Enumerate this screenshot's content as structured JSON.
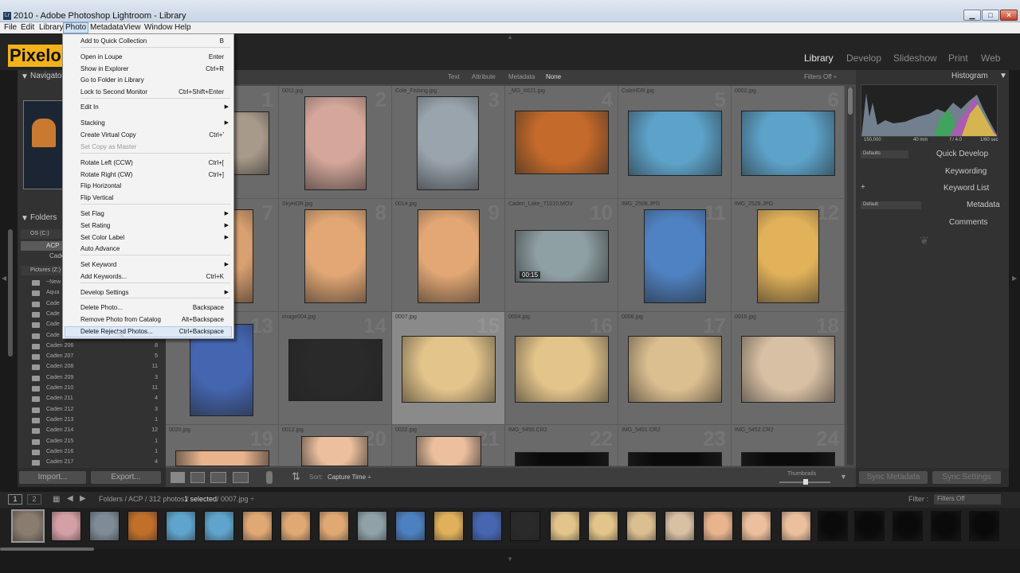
{
  "window": {
    "title": "2010 - Adobe Photoshop Lightroom - Library",
    "min": "▁",
    "max": "□",
    "close": "✕"
  },
  "menubar": [
    "File",
    "Edit",
    "Library",
    "Photo",
    "Metadata",
    "View",
    "Window",
    "Help"
  ],
  "logo": "Pixelo",
  "modules": [
    "Library",
    "Develop",
    "Slideshow",
    "Print",
    "Web"
  ],
  "filterbar": {
    "tabs": [
      "Text",
      "Attribute",
      "Metadata",
      "None"
    ],
    "status": "Filters Off ÷"
  },
  "left_panel": {
    "navigator": "Navigator",
    "folders": "Folders",
    "volume1": "OS (C:)",
    "volume2": "Pictures (Z:)",
    "acp": "ACP",
    "cade": "Cade",
    "folder_rows": [
      {
        "name": "~New",
        "count": ""
      },
      {
        "name": "Aqua",
        "count": ""
      },
      {
        "name": "Cade",
        "count": ""
      },
      {
        "name": "Cade",
        "count": ""
      },
      {
        "name": "Cade",
        "count": ""
      },
      {
        "name": "Cade",
        "count": ""
      },
      {
        "name": "Caden 206",
        "count": "8"
      },
      {
        "name": "Caden 207",
        "count": "5"
      },
      {
        "name": "Caden 208",
        "count": "11"
      },
      {
        "name": "Caden 209",
        "count": "3"
      },
      {
        "name": "Caden 210",
        "count": "11"
      },
      {
        "name": "Caden 211",
        "count": "4"
      },
      {
        "name": "Caden 212",
        "count": "3"
      },
      {
        "name": "Caden 213",
        "count": "1"
      },
      {
        "name": "Caden 214",
        "count": "12"
      },
      {
        "name": "Caden 215",
        "count": "1"
      },
      {
        "name": "Caden 216",
        "count": "1"
      },
      {
        "name": "Caden 217",
        "count": "4"
      }
    ]
  },
  "right_panel": {
    "histogram": "Histogram",
    "hist_info": [
      "150,000",
      "40 mm",
      "f / 4.0",
      "1/60 sec"
    ],
    "quick_develop": "Quick Develop",
    "keywording": "Keywording",
    "keyword_list": "Keyword List",
    "metadata": "Metadata",
    "comments": "Comments",
    "defaults": "Defaults",
    "default": "Default"
  },
  "grid": [
    {
      "file": "",
      "color": "#a89a8a"
    },
    {
      "file": "0011.jpg",
      "color": "#d4a79a"
    },
    {
      "file": "Cole_Fishing.jpg",
      "color": "#9aa4ad"
    },
    {
      "file": "_MG_8621.jpg",
      "color": "#c46a2a"
    },
    {
      "file": "ColeHDR.jpg",
      "color": "#5da2c9"
    },
    {
      "file": "0002.jpg",
      "color": "#5da2c9"
    },
    {
      "file": "",
      "color": "#d9a070"
    },
    {
      "file": "SkyHDR.jpg",
      "color": "#e2a774"
    },
    {
      "file": "0014.jpg",
      "color": "#e2a774"
    },
    {
      "file": "Caden_Lake_71010.MOV",
      "color": "#8fa0a4",
      "badge": "00:15"
    },
    {
      "file": "IMG_2508.JPG",
      "color": "#4f82c2"
    },
    {
      "file": "IMG_2528.JPG",
      "color": "#e2b25a"
    },
    {
      "file": "",
      "color": "#4465b0"
    },
    {
      "file": "image004.jpg",
      "color": "#2a2a2a"
    },
    {
      "file": "0007.jpg",
      "color": "#e3c48a"
    },
    {
      "file": "0004.jpg",
      "color": "#e3c48a"
    },
    {
      "file": "0008.jpg",
      "color": "#dcbf90"
    },
    {
      "file": "0016.jpg",
      "color": "#d8c0a4"
    },
    {
      "file": "0020.jpg",
      "color": "#e8b48e"
    },
    {
      "file": "0012.jpg",
      "color": "#ecc09e"
    },
    {
      "file": "0022.jpg",
      "color": "#ecc09e"
    },
    {
      "file": "IMG_5450.CR2",
      "color": "#0a0a0a"
    },
    {
      "file": "IMG_5451.CR2",
      "color": "#0a0a0a"
    },
    {
      "file": "IMG_5452.CR2",
      "color": "#0a0a0a"
    }
  ],
  "toolbar": {
    "sort_label": "Sort:",
    "sort_value": "Capture Time ÷",
    "thumbnails": "Thumbnails"
  },
  "buttons": {
    "import": "Import...",
    "export": "Export...",
    "sync_metadata": "Sync Metadata",
    "sync_settings": "Sync Settings"
  },
  "filmbar": {
    "page1": "1",
    "page2": "2",
    "path": "Folders / ACP / 312 photos /",
    "selected": "1 selected",
    "file": "/ 0007.jpg ÷",
    "filter_label": "Filter :",
    "filter_value": "Filters Off"
  },
  "filmstrip_colors": [
    "#8a7d70",
    "#d4a0a6",
    "#7f8b96",
    "#c0702a",
    "#5fa4cc",
    "#5fa4cc",
    "#e0a974",
    "#e0a974",
    "#e0a974",
    "#90a2a8",
    "#4d80c0",
    "#e0b05a",
    "#4666b2",
    "#2a2a2a",
    "#e3c48a",
    "#e3c48a",
    "#dcbf90",
    "#d8c0a4",
    "#e8b48e",
    "#ecc09e",
    "#ecc09e",
    "#0a0a0a",
    "#0a0a0a",
    "#0a0a0a",
    "#0a0a0a",
    "#0a0a0a"
  ],
  "menu": {
    "items": [
      {
        "label": "Add to Quick Collection",
        "shortcut": "B"
      },
      {
        "label": "Open in Loupe",
        "shortcut": "Enter"
      },
      {
        "label": "Show in Explorer",
        "shortcut": "Ctrl+R"
      },
      {
        "label": "Go to Folder in Library",
        "shortcut": ""
      },
      {
        "label": "Lock to Second Monitor",
        "shortcut": "Ctrl+Shift+Enter"
      },
      {
        "label": "Edit In",
        "shortcut": "",
        "submenu": true
      },
      {
        "label": "Stacking",
        "shortcut": "",
        "submenu": true
      },
      {
        "label": "Create Virtual Copy",
        "shortcut": "Ctrl+'"
      },
      {
        "label": "Set Copy as Master",
        "shortcut": "",
        "disabled": true
      },
      {
        "label": "Rotate Left (CCW)",
        "shortcut": "Ctrl+["
      },
      {
        "label": "Rotate Right (CW)",
        "shortcut": "Ctrl+]"
      },
      {
        "label": "Flip Horizontal",
        "shortcut": ""
      },
      {
        "label": "Flip Vertical",
        "shortcut": ""
      },
      {
        "label": "Set Flag",
        "shortcut": "",
        "submenu": true
      },
      {
        "label": "Set Rating",
        "shortcut": "",
        "submenu": true
      },
      {
        "label": "Set Color Label",
        "shortcut": "",
        "submenu": true
      },
      {
        "label": "Auto Advance",
        "shortcut": ""
      },
      {
        "label": "Set Keyword",
        "shortcut": "",
        "submenu": true
      },
      {
        "label": "Add Keywords...",
        "shortcut": "Ctrl+K"
      },
      {
        "label": "Develop Settings",
        "shortcut": "",
        "submenu": true
      },
      {
        "label": "Delete Photo...",
        "shortcut": "Backspace"
      },
      {
        "label": "Remove Photo from Catalog",
        "shortcut": "Alt+Backspace"
      },
      {
        "label": "Delete Rejected Photos...",
        "shortcut": "Ctrl+Backspace",
        "highlighted": true
      }
    ]
  }
}
